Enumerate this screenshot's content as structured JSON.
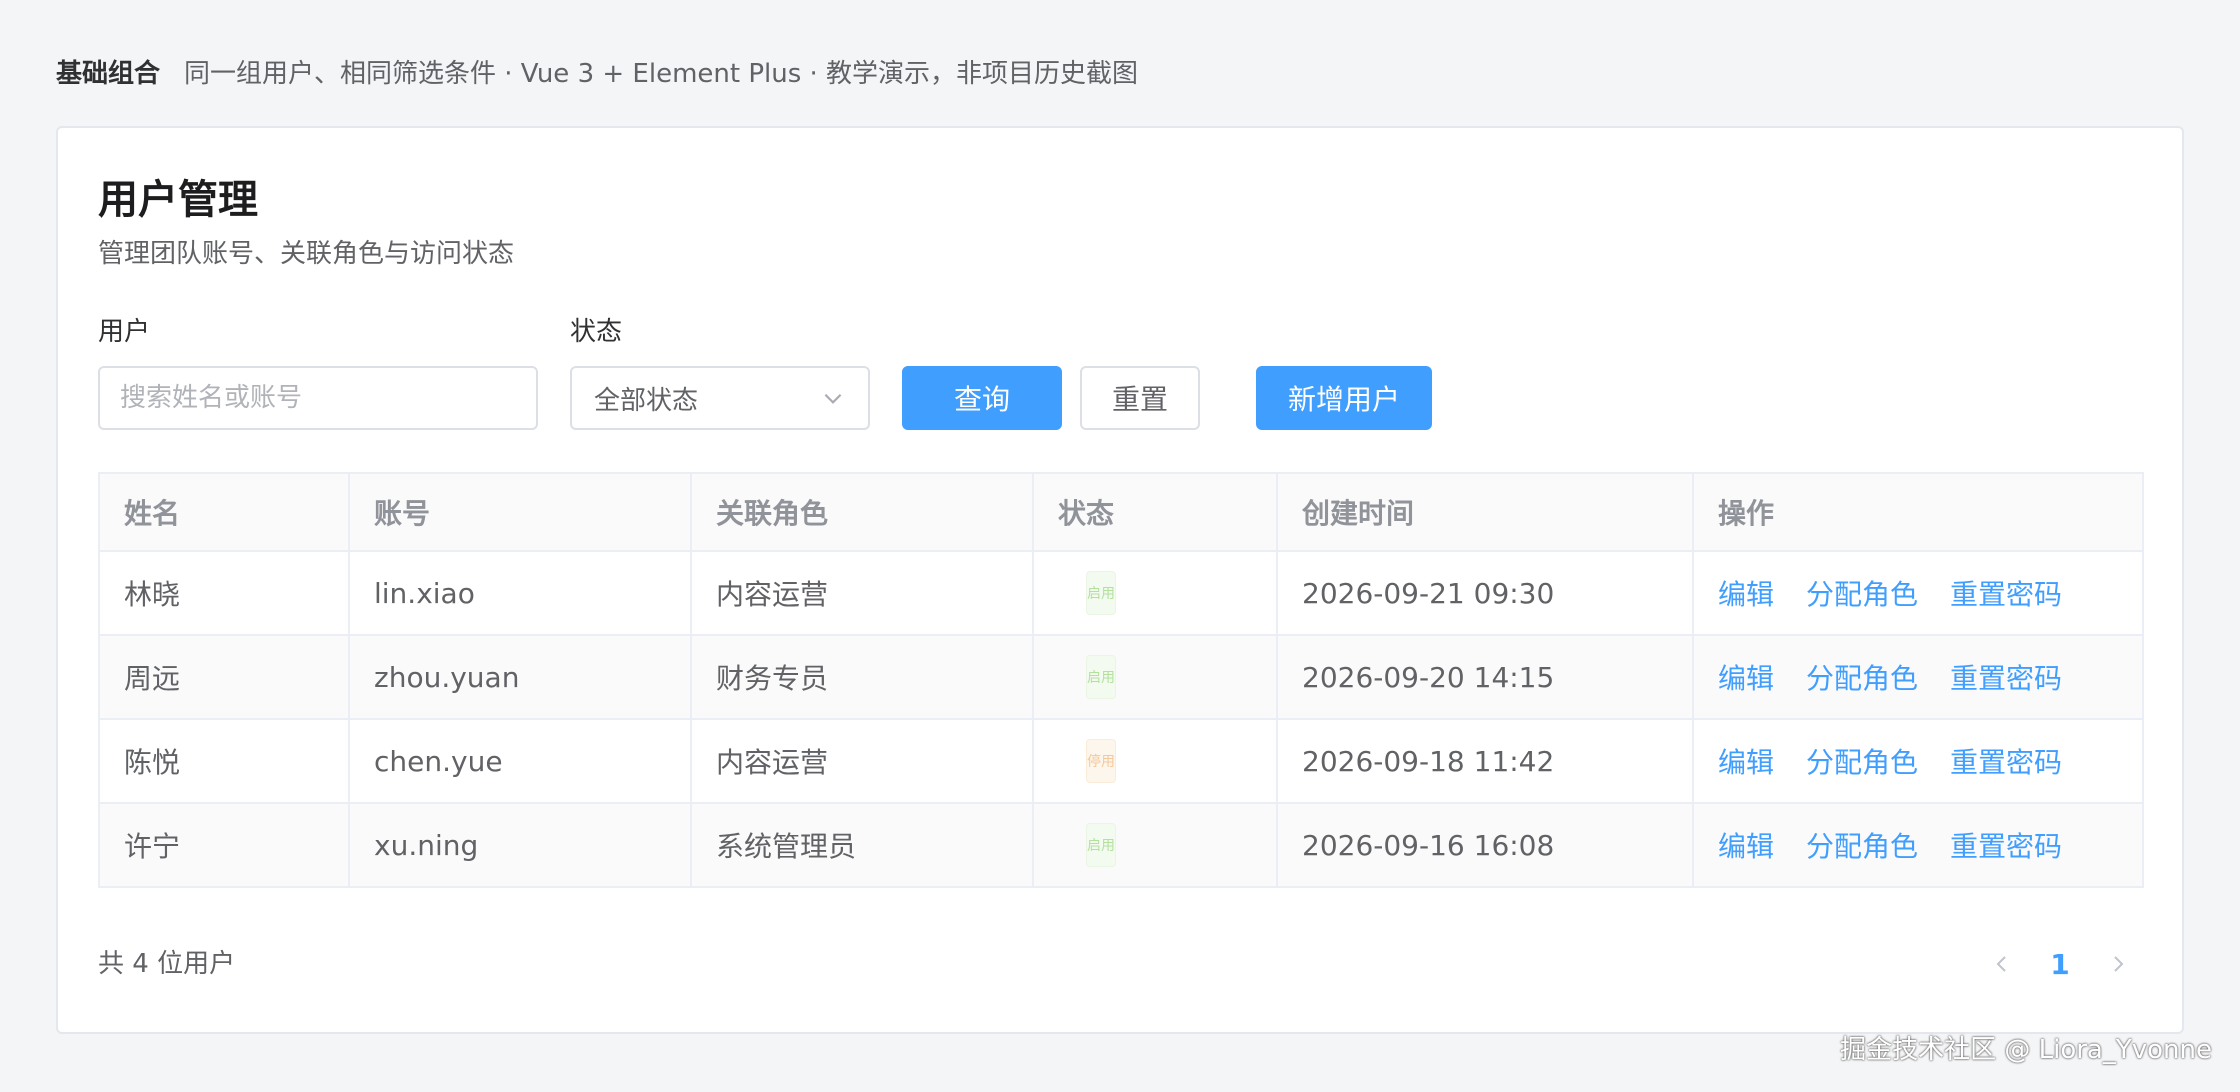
{
  "banner": {
    "tag": "基础组合",
    "description": "同一组用户、相同筛选条件 · Vue 3 + Element Plus · 教学演示，非项目历史截图"
  },
  "page": {
    "title": "用户管理",
    "subtitle": "管理团队账号、关联角色与访问状态"
  },
  "filters": {
    "user_label": "用户",
    "user_placeholder": "搜索姓名或账号",
    "user_value": "",
    "status_label": "状态",
    "status_value": "全部状态",
    "query_button": "查询",
    "reset_button": "重置",
    "add_button": "新增用户"
  },
  "table": {
    "columns": [
      "姓名",
      "账号",
      "关联角色",
      "状态",
      "创建时间",
      "操作"
    ],
    "rows": [
      {
        "name": "林晓",
        "account": "lin.xiao",
        "role": "内容运营",
        "status": "启用",
        "created": "2026-09-21 09:30"
      },
      {
        "name": "周远",
        "account": "zhou.yuan",
        "role": "财务专员",
        "status": "启用",
        "created": "2026-09-20 14:15"
      },
      {
        "name": "陈悦",
        "account": "chen.yue",
        "role": "内容运营",
        "status": "停用",
        "created": "2026-09-18 11:42"
      },
      {
        "name": "许宁",
        "account": "xu.ning",
        "role": "系统管理员",
        "status": "启用",
        "created": "2026-09-16 16:08"
      }
    ],
    "actions": {
      "edit": "编辑",
      "assign_role": "分配角色",
      "reset_password": "重置密码"
    }
  },
  "footer": {
    "total_text": "共 4 位用户",
    "current_page": "1"
  },
  "watermark": "掘金技术社区 @ Liora_Yvonne",
  "colors": {
    "primary": "#409eff",
    "status_enabled": "#b3e19d",
    "status_disabled": "#f3c89a"
  }
}
